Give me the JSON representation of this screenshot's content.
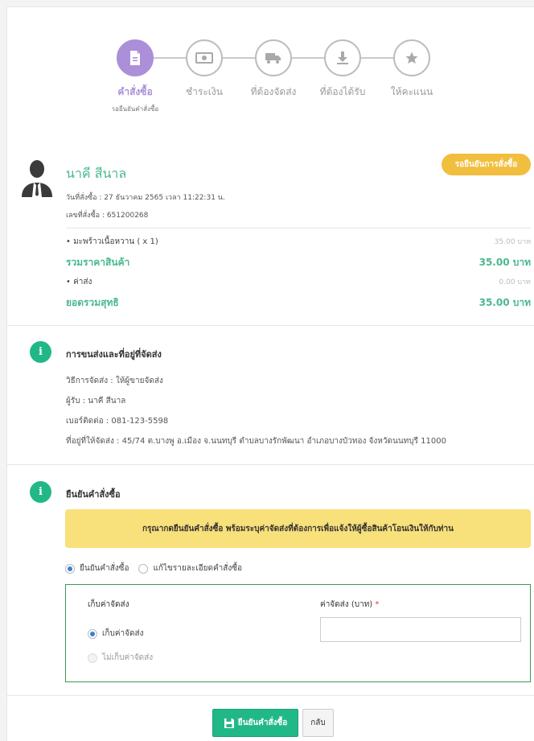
{
  "steps": [
    {
      "label": "คำสั่งซื้อ",
      "sub": "รอยืนยันคำสั่งซื้อ",
      "icon": "document-icon",
      "active": true
    },
    {
      "label": "ชำระเงิน",
      "icon": "banknote-icon",
      "active": false
    },
    {
      "label": "ที่ต้องจัดส่ง",
      "icon": "truck-icon",
      "active": false
    },
    {
      "label": "ที่ต้องได้รับ",
      "icon": "download-icon",
      "active": false
    },
    {
      "label": "ให้คะแนน",
      "icon": "star-icon",
      "active": false
    }
  ],
  "order": {
    "buyer_name": "นาคี สีนาล",
    "status_badge": "รอยืนยันการสั่งซื้อ",
    "order_date": "วันที่สั่งซื้อ : 27 ธันวาคม 2565 เวลา 11:22:31 น.",
    "order_number": "เลขที่สั่งซื้อ : 651200268",
    "item_label": "• มะพร้าวเนื้อหวาน ( x 1)",
    "item_amount": "35.00 บาท",
    "subtotal_label": "รวมราคาสินค้า",
    "subtotal_amount": "35.00 บาท",
    "shipping_label": "• ค่าส่ง",
    "shipping_amount": "0.00 บาท",
    "total_label": "ยอดรวมสุทธิ",
    "total_amount": "35.00 บาท"
  },
  "shipping": {
    "title": "การขนส่งและที่อยู่ที่จัดส่ง",
    "method": "วิธีการจัดส่ง : ให้ผู้ขายจัดส่ง",
    "recipient": "ผู้รับ : นาคี สีนาล",
    "phone": "เบอร์ติดต่อ : 081-123-5598",
    "address": "ที่อยู่ที่ให้จัดส่ง : 45/74 ต.บางพู อ.เมือง จ.นนทบุรี ตำบลบางรักพัฒนา อำเภอบางบัวทอง จังหวัดนนทบุรี 11000"
  },
  "confirm": {
    "title": "ยืนยันคำสั่งซื้อ",
    "notice": "กรุณากดยืนยันคำสั่งซื้อ พร้อมระบุค่าจัดส่งที่ต้องการเพื่อแจ้งให้ผู้ซื้อสินค้าโอนเงินให้กับท่าน",
    "option_confirm": "ยืนยันคำสั่งซื้อ",
    "option_edit": "แก้ไขรายละเอียดคำสั่งซื้อ",
    "collect_label": "เก็บค่าจัดส่ง",
    "collect_yes": "เก็บค่าจัดส่ง",
    "collect_no": "ไม่เก็บค่าจัดส่ง",
    "fee_label": "ค่าจัดส่ง (บาท)",
    "fee_value": "",
    "confirm_button": "ยืนยันคำสั่งซื้อ",
    "back_button": "กลับ"
  },
  "colors": {
    "accent_green": "#21b888",
    "step_active": "#ac8fd9",
    "badge": "#f1be3e",
    "notice_bg": "#f8e07a"
  }
}
